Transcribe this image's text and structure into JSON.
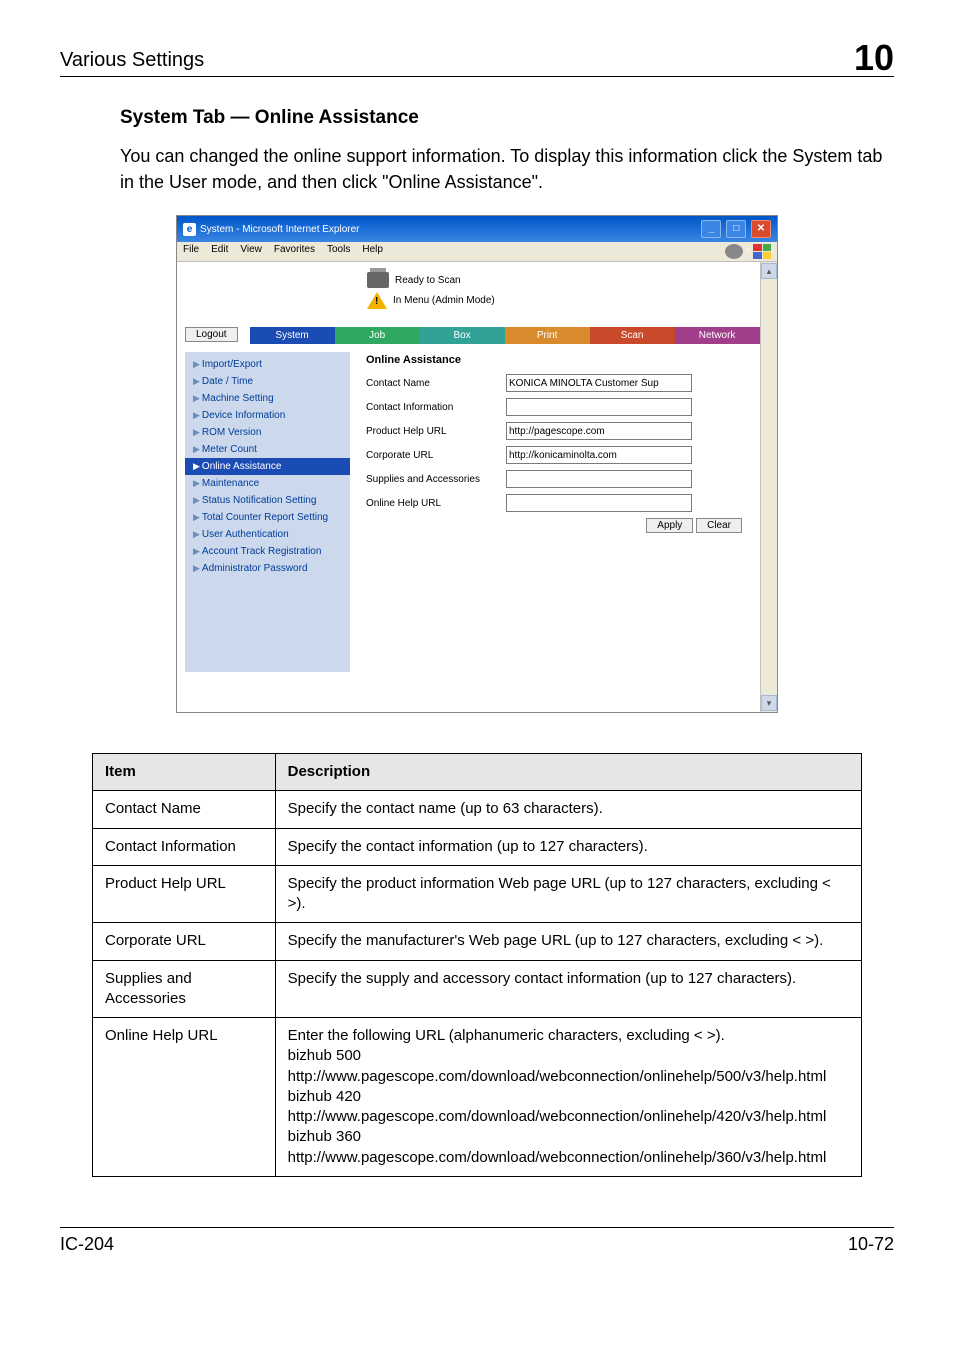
{
  "header": {
    "left": "Various Settings",
    "right": "10"
  },
  "section": {
    "title": "System Tab — Online Assistance",
    "intro": "You can changed the online support information. To display this information click the System tab in the User mode, and then click \"Online Assistance\"."
  },
  "screenshot": {
    "title": "System - Microsoft Internet Explorer",
    "menus": [
      "File",
      "Edit",
      "View",
      "Favorites",
      "Tools",
      "Help"
    ],
    "status1": "Ready to Scan",
    "status2": "In Menu (Admin Mode)",
    "logout": "Logout",
    "tabs": {
      "system": "System",
      "job": "Job",
      "box": "Box",
      "print": "Print",
      "scan": "Scan",
      "network": "Network"
    },
    "side": [
      "Import/Export",
      "Date / Time",
      "Machine Setting",
      "Device Information",
      "ROM Version",
      "Meter Count",
      "Online Assistance",
      "Maintenance",
      "Status Notification Setting",
      "Total Counter Report Setting",
      "User Authentication",
      "Account Track Registration",
      "Administrator Password"
    ],
    "side_active_index": 6,
    "content": {
      "heading": "Online Assistance",
      "fields": [
        {
          "label": "Contact Name",
          "value": "KONICA MINOLTA Customer Sup"
        },
        {
          "label": "Contact Information",
          "value": ""
        },
        {
          "label": "Product Help URL",
          "value": "http://pagescope.com"
        },
        {
          "label": "Corporate URL",
          "value": "http://konicaminolta.com"
        },
        {
          "label": "Supplies and Accessories",
          "value": ""
        },
        {
          "label": "Online Help URL",
          "value": ""
        }
      ],
      "apply": "Apply",
      "clear": "Clear"
    }
  },
  "table": {
    "head_item": "Item",
    "head_desc": "Description",
    "rows": [
      {
        "item": "Contact Name",
        "desc": "Specify the contact name (up to 63 characters)."
      },
      {
        "item": "Contact Information",
        "desc": "Specify the contact information (up to 127 characters)."
      },
      {
        "item": "Product Help URL",
        "desc": "Specify the product information Web page URL (up to 127 characters, excluding < >)."
      },
      {
        "item": "Corporate URL",
        "desc": "Specify the manufacturer's Web page URL (up to 127 characters, excluding < >)."
      },
      {
        "item": "Supplies and Accessories",
        "desc": "Specify the supply and accessory contact information (up to 127 characters)."
      },
      {
        "item": "Online Help URL",
        "desc": "Enter the following URL (alphanumeric characters, excluding < >).\nbizhub 500\nhttp://www.pagescope.com/download/webconnection/onlinehelp/500/v3/help.html\nbizhub 420\nhttp://www.pagescope.com/download/webconnection/onlinehelp/420/v3/help.html\nbizhub 360\nhttp://www.pagescope.com/download/webconnection/onlinehelp/360/v3/help.html"
      }
    ]
  },
  "footer": {
    "left": "IC-204",
    "right": "10-72"
  }
}
